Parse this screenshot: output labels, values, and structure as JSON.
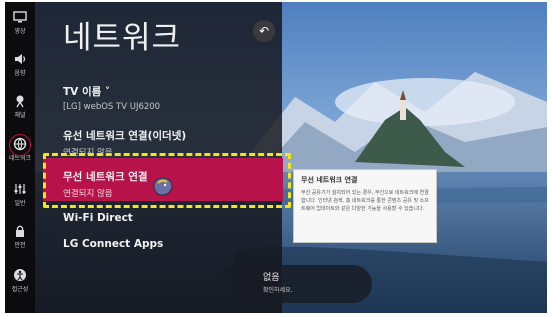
{
  "rail": {
    "items": [
      {
        "label": "영상",
        "icon": "picture-icon"
      },
      {
        "label": "음향",
        "icon": "speaker-icon"
      },
      {
        "label": "채널",
        "icon": "antenna-icon"
      },
      {
        "label": "네트워크",
        "icon": "globe-icon"
      },
      {
        "label": "일반",
        "icon": "settings-sliders-icon"
      },
      {
        "label": "안전",
        "icon": "lock-icon"
      },
      {
        "label": "접근성",
        "icon": "accessibility-icon"
      }
    ]
  },
  "panel": {
    "title": "네트워크",
    "back_icon": "back-icon",
    "items": [
      {
        "label": "TV 이름 ˅",
        "value": "[LG] webOS TV UJ6200"
      },
      {
        "label": "유선 네트워크 연결(이더넷)",
        "value": "연결되지 않음"
      },
      {
        "label": "무선 네트워크 연결",
        "value": "연결되지 않음"
      },
      {
        "label": "Wi-Fi Direct",
        "value": ""
      },
      {
        "label": "LG Connect Apps",
        "value": ""
      }
    ]
  },
  "info_box": {
    "title": "무선 네트워크 연결",
    "body": "무선 공유기가 설치되어 있는 경우, 무선으로 네트워크에 연결합니다. 인터넷 검색, 홈 네트워크를 통한 콘텐츠 공유 및 소프트웨어 업데이트와 같은 다양한 기능을 사용할 수 있습니다."
  },
  "toast": {
    "line1": "없음",
    "line2": "확인하세요."
  },
  "colors": {
    "selected": "#b8124a",
    "highlight_border": "#f7e51c",
    "active_ring": "#c0123f"
  }
}
